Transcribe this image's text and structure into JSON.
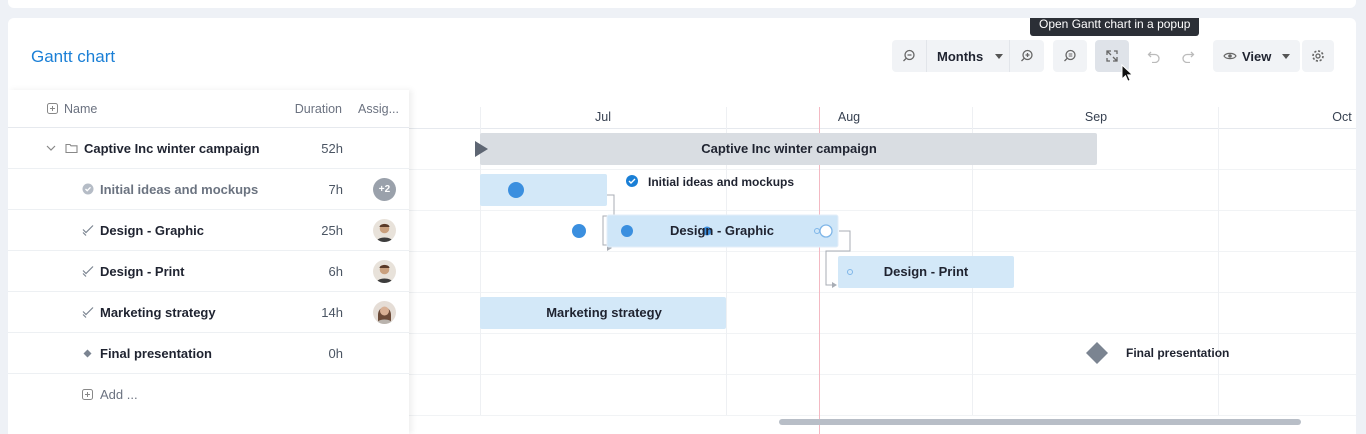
{
  "header": {
    "title": "Gantt chart"
  },
  "toolbar": {
    "zoom_level": "Months",
    "view_label": "View",
    "tooltip": "Open Gantt chart in a popup"
  },
  "grid": {
    "columns": {
      "name": "Name",
      "duration": "Duration",
      "assignees": "Assig..."
    },
    "rows": [
      {
        "name": "Captive Inc winter campaign",
        "duration": "52h",
        "assignee": ""
      },
      {
        "name": "Initial ideas and mockups",
        "duration": "7h",
        "assignee": "+2"
      },
      {
        "name": "Design - Graphic",
        "duration": "25h",
        "assignee": "man-avatar"
      },
      {
        "name": "Design - Print",
        "duration": "6h",
        "assignee": "man-avatar"
      },
      {
        "name": "Marketing strategy",
        "duration": "14h",
        "assignee": "woman-avatar"
      },
      {
        "name": "Final presentation",
        "duration": "0h",
        "assignee": ""
      }
    ],
    "add_label": "Add ..."
  },
  "timeline": {
    "months": [
      "Jul",
      "Aug",
      "Sep",
      "Oct"
    ],
    "bars": {
      "campaign": "Captive Inc winter campaign",
      "ideas": "Initial ideas and mockups",
      "graphic": "Design - Graphic",
      "print": "Design - Print",
      "marketing": "Marketing strategy",
      "milestone": "Final presentation"
    }
  },
  "colors": {
    "accent": "#1a7fd6",
    "task_bar": "#d3e8f8",
    "summary_bar": "#d9dde2",
    "today_line": "#f3b9c3",
    "milestone": "#7b8491"
  }
}
